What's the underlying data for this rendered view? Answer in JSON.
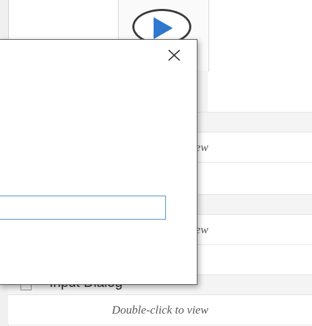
{
  "activities": [
    {
      "title": "",
      "hint": "Double-click to view"
    },
    {
      "title": "",
      "hint": "Double-click to view"
    },
    {
      "title": "Input Dialog",
      "hint": "Double-click to view"
    }
  ],
  "dialog": {
    "close_glyph": "✕",
    "input_value": ""
  },
  "colors": {
    "run_icon": "#2f78cf",
    "input_border": "#4a90c8",
    "dialog_border": "#5a5a5a"
  }
}
